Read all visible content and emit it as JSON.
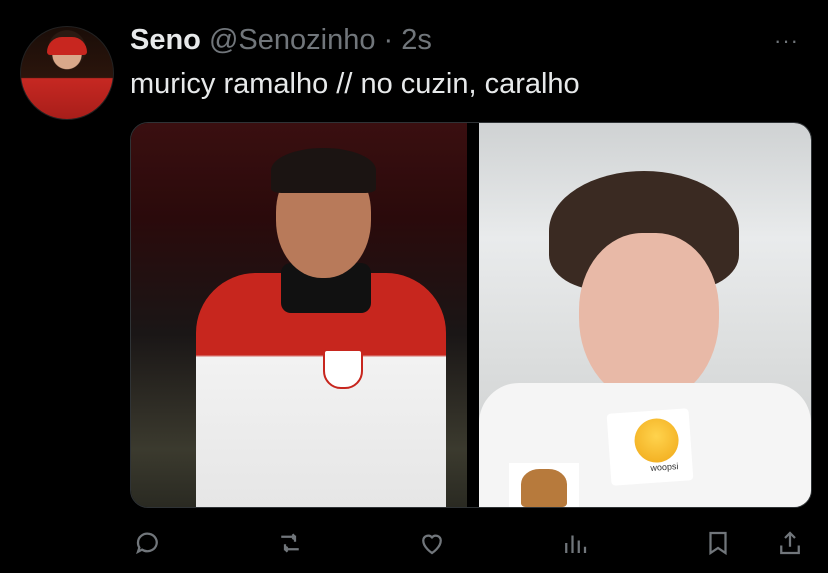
{
  "tweet": {
    "author_name": "Seno",
    "author_handle": "@Senozinho",
    "separator": "·",
    "timestamp": "2s",
    "text": "muricy ramalho // no cuzin, caralho",
    "more_label": "···"
  },
  "media": {
    "sticker_text": "woopsi"
  },
  "actions": [
    {
      "name": "reply-icon"
    },
    {
      "name": "retweet-icon"
    },
    {
      "name": "like-icon"
    },
    {
      "name": "views-icon"
    },
    {
      "name": "bookmark-icon"
    },
    {
      "name": "share-icon"
    }
  ],
  "colors": {
    "text_primary": "#e7e9ea",
    "text_secondary": "#71767b",
    "background": "#000000"
  }
}
